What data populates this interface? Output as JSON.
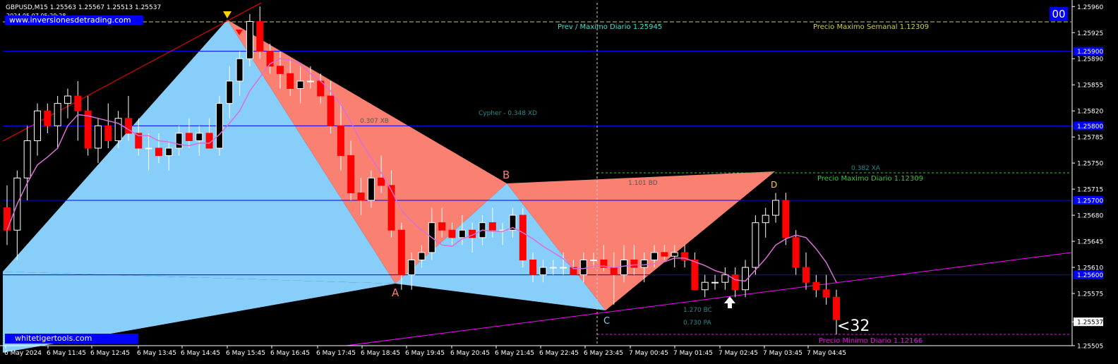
{
  "header": {
    "symbol": "GBPUSD,M15  1.25563 1.25567 1.25513 1.25537",
    "datetime": "2024.05.07 05:29:28",
    "website": "www.inversionesdetrading.com",
    "website2": "whitetigertools.com",
    "timer": "00",
    "countdown": "<32",
    "watermark": "##"
  },
  "labels": {
    "prev_max": "Prev / Maximo Diario 1.25945",
    "max_semanal": "Precio Maximo Semanal 1.12309",
    "max_diario": "Precio Maximo Diario 1.12309",
    "min_diario": "Precio Minimo Diario 1.12166",
    "cypher": "Cypher - 0.348 XD",
    "xb": "0.307 XB",
    "bd": "1.101 BD",
    "bc": "1.270 BC",
    "pa": "0.730 PA",
    "xa": "0.382 XA",
    "pt_b": "B",
    "pt_a": "A",
    "pt_c": "C",
    "pt_d": "D"
  },
  "colors": {
    "background": "#000000",
    "bull_candle": "#ffffff",
    "bear_candle": "#ff0000",
    "pattern_blue": "#87cefa",
    "pattern_red": "#fa8072",
    "ma_line": "#da70d6",
    "level_line": "#0000ff",
    "trend_line": "#ff00ff",
    "resist_line": "#ff0000"
  },
  "chart_data": {
    "type": "candlestick",
    "symbol": "GBPUSD",
    "timeframe": "M15",
    "ylim": [
      1.25505,
      1.25965
    ],
    "y_ticks": [
      "1.25960",
      "1.25925",
      "1.25890",
      "1.25855",
      "1.25820",
      "1.25785",
      "1.25750",
      "1.25715",
      "1.25680",
      "1.25645",
      "1.25610",
      "1.25575",
      "1.25537",
      "1.25505"
    ],
    "x_ticks": [
      "6 May 2024",
      "6 May 11:45",
      "6 May 12:45",
      "6 May 13:45",
      "6 May 14:45",
      "6 May 15:45",
      "6 May 16:45",
      "6 May 17:45",
      "6 May 18:45",
      "6 May 19:45",
      "6 May 20:45",
      "6 May 21:45",
      "6 May 22:45",
      "6 May 23:45",
      "7 May 00:45",
      "7 May 01:45",
      "7 May 02:45",
      "7 May 03:45",
      "7 May 04:45"
    ],
    "horizontal_levels": [
      1.259,
      1.258,
      1.257,
      1.256
    ],
    "highlighted_levels": [
      "1.25900",
      "1.25800",
      "1.25700",
      "1.25600"
    ],
    "current_price": "1.25537",
    "candles": [
      [
        1.2569,
        1.2572,
        1.2564,
        1.2566
      ],
      [
        1.2566,
        1.2574,
        1.2562,
        1.2573
      ],
      [
        1.2573,
        1.258,
        1.257,
        1.2578
      ],
      [
        1.2578,
        1.2583,
        1.2576,
        1.2582
      ],
      [
        1.2582,
        1.2583,
        1.2579,
        1.258
      ],
      [
        1.258,
        1.2584,
        1.2577,
        1.2583
      ],
      [
        1.2583,
        1.2585,
        1.2581,
        1.2584
      ],
      [
        1.2584,
        1.2586,
        1.2578,
        1.2582
      ],
      [
        1.2582,
        1.2584,
        1.2576,
        1.2577
      ],
      [
        1.2577,
        1.2581,
        1.2575,
        1.258
      ],
      [
        1.258,
        1.2583,
        1.2577,
        1.2578
      ],
      [
        1.2578,
        1.2582,
        1.2577,
        1.2581
      ],
      [
        1.2581,
        1.2584,
        1.2578,
        1.2579
      ],
      [
        1.2579,
        1.2581,
        1.2576,
        1.2577
      ],
      [
        1.2577,
        1.2579,
        1.2574,
        1.2577
      ],
      [
        1.2577,
        1.2579,
        1.2575,
        1.2576
      ],
      [
        1.2576,
        1.2578,
        1.2574,
        1.2577
      ],
      [
        1.2577,
        1.258,
        1.2576,
        1.2579
      ],
      [
        1.2579,
        1.2581,
        1.2577,
        1.2578
      ],
      [
        1.2578,
        1.258,
        1.2576,
        1.2579
      ],
      [
        1.2579,
        1.2581,
        1.2577,
        1.2577
      ],
      [
        1.2577,
        1.2584,
        1.2576,
        1.2583
      ],
      [
        1.2583,
        1.2588,
        1.2581,
        1.2586
      ],
      [
        1.2586,
        1.259,
        1.2584,
        1.2589
      ],
      [
        1.2589,
        1.2595,
        1.2588,
        1.2594
      ],
      [
        1.2594,
        1.2596,
        1.2589,
        1.259
      ],
      [
        1.259,
        1.2591,
        1.2587,
        1.2588
      ],
      [
        1.2588,
        1.259,
        1.2585,
        1.2587
      ],
      [
        1.2587,
        1.2589,
        1.2584,
        1.2585
      ],
      [
        1.2585,
        1.2588,
        1.2583,
        1.2586
      ],
      [
        1.2586,
        1.2588,
        1.2585,
        1.2586
      ],
      [
        1.2586,
        1.2587,
        1.2583,
        1.2584
      ],
      [
        1.2584,
        1.2586,
        1.2579,
        1.258
      ],
      [
        1.258,
        1.2583,
        1.2574,
        1.2576
      ],
      [
        1.2576,
        1.2578,
        1.257,
        1.2571
      ],
      [
        1.2571,
        1.2573,
        1.2568,
        1.257
      ],
      [
        1.257,
        1.2574,
        1.2569,
        1.2573
      ],
      [
        1.2573,
        1.2576,
        1.2571,
        1.2572
      ],
      [
        1.2572,
        1.2574,
        1.2565,
        1.2566
      ],
      [
        1.2566,
        1.2567,
        1.2558,
        1.256
      ],
      [
        1.256,
        1.2563,
        1.2558,
        1.2562
      ],
      [
        1.2562,
        1.2564,
        1.2561,
        1.2563
      ],
      [
        1.2563,
        1.2569,
        1.2562,
        1.2567
      ],
      [
        1.2567,
        1.2569,
        1.2565,
        1.2566
      ],
      [
        1.2566,
        1.2567,
        1.2564,
        1.2565
      ],
      [
        1.2565,
        1.2568,
        1.2564,
        1.2566
      ],
      [
        1.2566,
        1.2567,
        1.2563,
        1.2565
      ],
      [
        1.2565,
        1.2568,
        1.2564,
        1.2567
      ],
      [
        1.2567,
        1.2569,
        1.2565,
        1.2566
      ],
      [
        1.2566,
        1.2567,
        1.2564,
        1.2566
      ],
      [
        1.2566,
        1.2569,
        1.2565,
        1.2568
      ],
      [
        1.2568,
        1.2569,
        1.2561,
        1.2562
      ],
      [
        1.2562,
        1.2563,
        1.2559,
        1.256
      ],
      [
        1.256,
        1.2562,
        1.2559,
        1.2561
      ],
      [
        1.2561,
        1.2562,
        1.256,
        1.2561
      ],
      [
        1.2561,
        1.2563,
        1.256,
        1.2561
      ],
      [
        1.2561,
        1.2562,
        1.256,
        1.256
      ],
      [
        1.256,
        1.2563,
        1.2559,
        1.2562
      ],
      [
        1.2562,
        1.2563,
        1.2561,
        1.2562
      ],
      [
        1.2562,
        1.2564,
        1.25605,
        1.2561
      ],
      [
        1.2561,
        1.2563,
        1.2556,
        1.256
      ],
      [
        1.256,
        1.2564,
        1.2559,
        1.2562
      ],
      [
        1.2562,
        1.2564,
        1.256,
        1.2561
      ],
      [
        1.2561,
        1.2563,
        1.2559,
        1.2562
      ],
      [
        1.2562,
        1.2564,
        1.2561,
        1.2563
      ],
      [
        1.2563,
        1.2564,
        1.2562,
        1.25625
      ],
      [
        1.25625,
        1.2564,
        1.2561,
        1.2563
      ],
      [
        1.2563,
        1.2564,
        1.2561,
        1.2562
      ],
      [
        1.2562,
        1.2563,
        1.2559,
        1.2558
      ],
      [
        1.2558,
        1.256,
        1.2557,
        1.2559
      ],
      [
        1.2559,
        1.256,
        1.2558,
        1.2559
      ],
      [
        1.2559,
        1.2561,
        1.2558,
        1.256
      ],
      [
        1.256,
        1.2561,
        1.2557,
        1.2558
      ],
      [
        1.2558,
        1.2562,
        1.2557,
        1.2561
      ],
      [
        1.2561,
        1.2568,
        1.256,
        1.2567
      ],
      [
        1.2567,
        1.2569,
        1.2565,
        1.2568
      ],
      [
        1.2568,
        1.2571,
        1.2567,
        1.257
      ],
      [
        1.257,
        1.2571,
        1.2564,
        1.2565
      ],
      [
        1.2565,
        1.2566,
        1.256,
        1.2561
      ],
      [
        1.2561,
        1.2563,
        1.2558,
        1.2559
      ],
      [
        1.2559,
        1.256,
        1.2557,
        1.2558
      ],
      [
        1.2558,
        1.256,
        1.2556,
        1.2557
      ],
      [
        1.2557,
        1.2558,
        1.2552,
        1.2554
      ]
    ]
  }
}
